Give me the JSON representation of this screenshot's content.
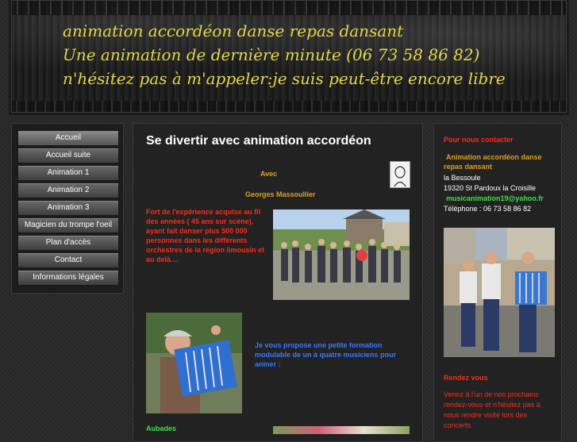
{
  "banner": {
    "line1": "animation accordéon danse repas dansant",
    "line2": "Une animation de dernière minute   (06 73 58 86 82)",
    "line3": "n'hésitez pas à m'appeler:je suis peut-être encore libre"
  },
  "nav": {
    "items": [
      {
        "label": "Accueil"
      },
      {
        "label": "Accueil suite"
      },
      {
        "label": "Animation 1"
      },
      {
        "label": "Animation 2"
      },
      {
        "label": "Animation 3"
      },
      {
        "label": "Magicien du trompe l'oeil"
      },
      {
        "label": "Plan d'accès"
      },
      {
        "label": "Contact"
      },
      {
        "label": "Informations légales"
      }
    ]
  },
  "main": {
    "title": "Se divertir avec animation accordéon",
    "avec": "Avec",
    "name": "Georges Massoullier",
    "red_paragraph": "Fort de l'expérience  acquise au fil des années  ( 45 ans sur scène), ayant fait danser plus 500 000 personnes dans les différents orchestres de la région limousin et au delà....",
    "blue_paragraph": "Je vous propose une petite formation modulable de un à quatre musiciens pour aniner :",
    "aubades": "Aubades"
  },
  "aside": {
    "contact_title": "Pour nous contacter",
    "company_line1": "Animation accordéon danse",
    "company_line2": "repas dansant",
    "address1": "la Bessoule",
    "address2": "19320 St Pardoux la Croisille",
    "email": "musicanimation19@yahoo.fr",
    "phone": "Téléphone :  06 73 58 86 82",
    "rendezvous_title": "Rendez vous",
    "rendezvous_text1": "Venez à l'un de nos prochains",
    "rendezvous_text2": "rendez-vous et n'hésitez pas à",
    "rendezvous_text3": "nous rendre visite lors des",
    "rendezvous_text4": "concerts."
  },
  "colors": {
    "banner_text": "#e4d74a",
    "heading_orange": "#e0a020",
    "red_text": "#ff2a1a",
    "blue_text": "#3b78ff",
    "email_green": "#3ee04a"
  }
}
